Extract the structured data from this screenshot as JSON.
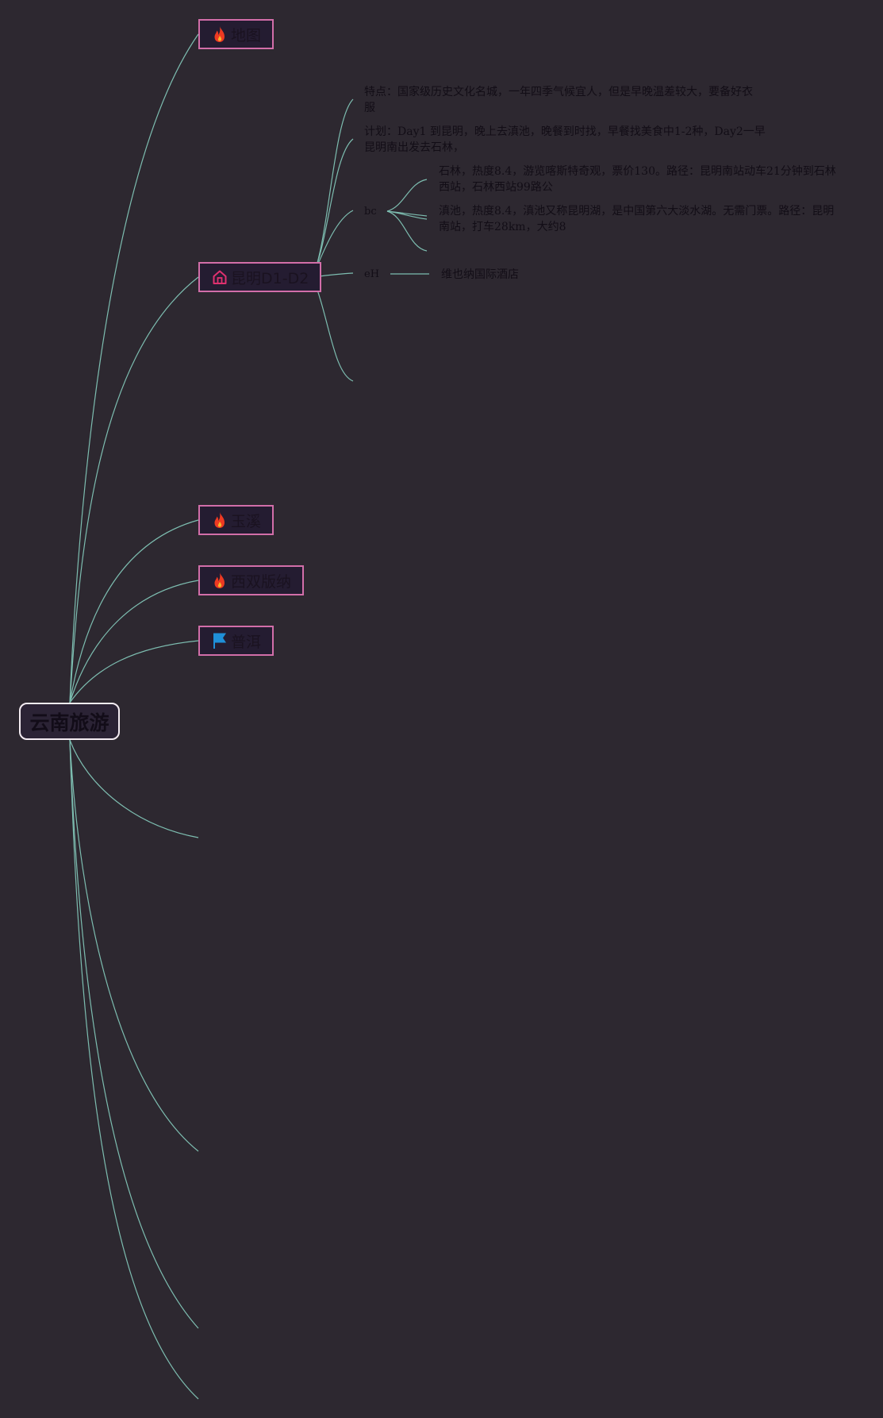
{
  "root": {
    "label": "云南旅游"
  },
  "branches": [
    {
      "label": "地图",
      "icon": "fire-icon"
    },
    {
      "label": "昆明D1-D2",
      "icon": "home-icon"
    },
    {
      "label": "玉溪",
      "icon": "fire-icon"
    },
    {
      "label": "西双版纳",
      "icon": "fire-icon"
    },
    {
      "label": "普洱",
      "icon": "flag-icon"
    }
  ],
  "kunming": {
    "feature_line1": "特点：国家级历史文化名城，一年四季气候宜人，但是早晚温差较大，要备好衣",
    "feature_line2": "服",
    "plan_line1": "计划：Day1 到昆明，晚上去滇池，晚餐到时找，早餐找美食中1-2种，Day2一早",
    "plan_line2": "昆明南出发去石林，",
    "bc_label": "bc",
    "bc_items": [
      {
        "line1": "石林，热度8.4，游览喀斯特奇观，票价130。路径：昆明南站动车21分钟到石林",
        "line2": "西站，石林西站99路公"
      },
      {
        "line1": "滇池，热度8.4，滇池又称昆明湖，是中国第六大淡水湖。无需门票。路径：昆明",
        "line2": "南站，打车28km，大约8"
      }
    ],
    "eh_label": "eH",
    "hotel": "维也纳国际酒店"
  },
  "colors": {
    "background": "#2d2830",
    "connector": "#7dbdb0",
    "branch_border": "#d26ea9",
    "branch_fill": "#241c31",
    "root_border": "#f4ecf2",
    "fire": "#ee3a22",
    "home": "#e0316f",
    "flag": "#1f8fd8"
  }
}
